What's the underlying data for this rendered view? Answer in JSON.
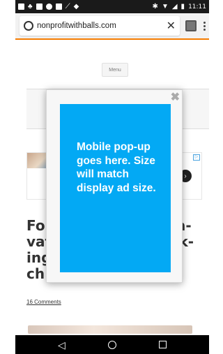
{
  "status_bar": {
    "time": "11:11",
    "icons": [
      "facebook-icon",
      "notification-icon",
      "message-icon",
      "sync-icon",
      "image-icon",
      "scribble-icon",
      "lock-icon",
      "bluetooth-icon",
      "wifi-icon",
      "signal-icon",
      "battery-icon"
    ]
  },
  "browser": {
    "url": "nonprofitwithballs.com",
    "clear_glyph": "✕"
  },
  "page": {
    "menu_label": "Menu",
    "title_left": "Fou\nvat\ning\nch",
    "title_right": "ra-\nak-",
    "comments": "16 Comments",
    "ad_badge": "▷"
  },
  "popup": {
    "close_glyph": "✖",
    "text": "Mobile pop-up goes here. Size will match display ad size.",
    "bg_color": "#03a9f4"
  },
  "nav": {
    "back_glyph": "◁"
  }
}
